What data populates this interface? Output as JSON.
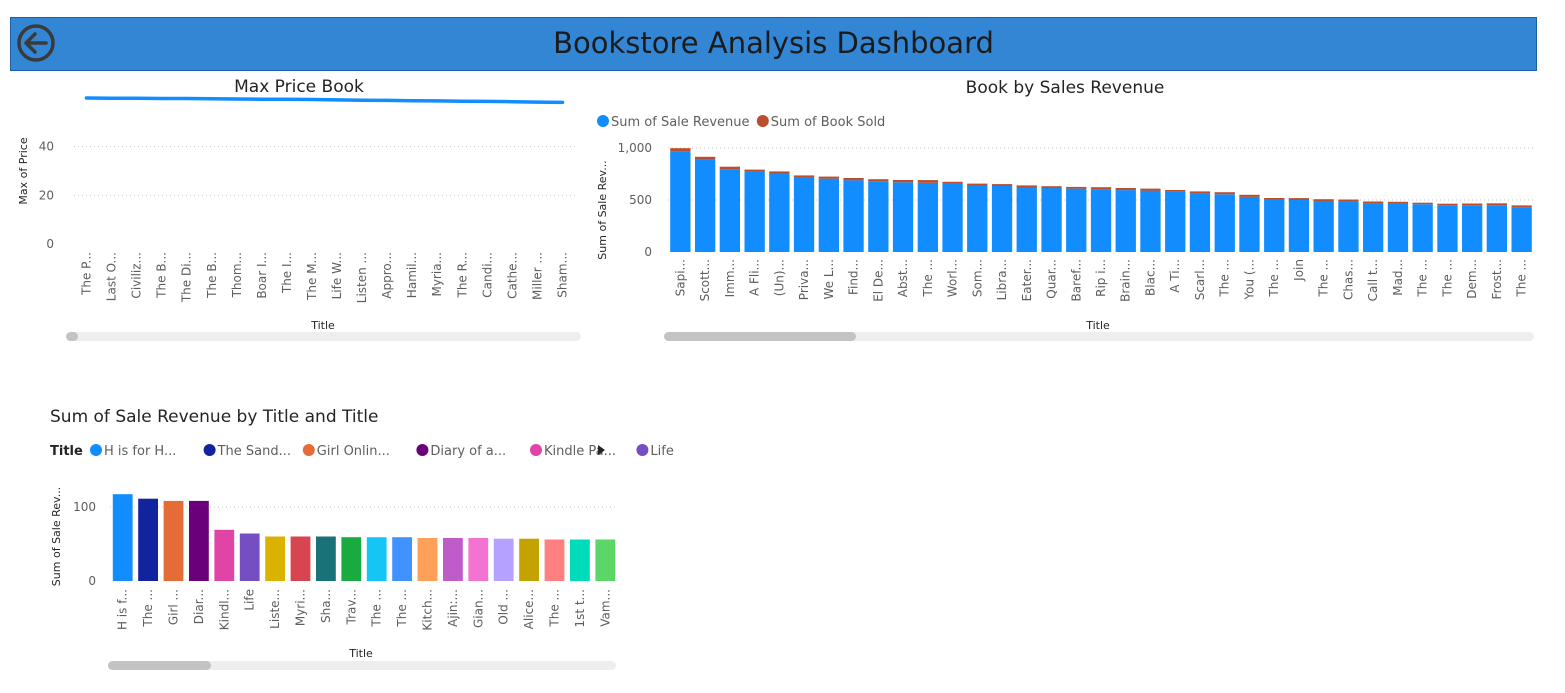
{
  "header": {
    "title": "Bookstore Analysis Dashboard",
    "back_icon": "back-arrow-circle-icon",
    "color": "#3386d4"
  },
  "chart_data": [
    {
      "id": "max_price",
      "type": "line",
      "title": "Max Price Book",
      "xlabel": "Title",
      "ylabel": "Max of Price",
      "ylim": [
        0,
        60
      ],
      "yticks": [
        0,
        20,
        40
      ],
      "grid": true,
      "color": "#118dff",
      "categories": [
        "The P...",
        "Last O...",
        "Civiliz...",
        "The B...",
        "The Di...",
        "The B...",
        "Thom...",
        "Boar I...",
        "The I...",
        "The M...",
        "Life W...",
        "Listen ...",
        "Appro...",
        "Hamil...",
        "Myria...",
        "The R...",
        "Candi...",
        "Cathe...",
        "Miller ...",
        "Sham..."
      ],
      "values": [
        60.0,
        59.9,
        59.9,
        59.8,
        59.8,
        59.7,
        59.6,
        59.5,
        59.5,
        59.4,
        59.2,
        59.1,
        59.0,
        58.9,
        58.8,
        58.7,
        58.6,
        58.5,
        58.3,
        58.2
      ]
    },
    {
      "id": "sales_revenue",
      "type": "bar",
      "stacked": true,
      "title": "Book by Sales Revenue",
      "xlabel": "Title",
      "ylabel": "Sum of Sale Rev...",
      "ylim": [
        0,
        1000
      ],
      "yticks": [
        0,
        500,
        1000
      ],
      "ytick_labels": [
        "0",
        "500",
        "1,000"
      ],
      "grid": true,
      "legend_position": "top-left",
      "categories": [
        "Sapi...",
        "Scott...",
        "Imm...",
        "A Fli...",
        "(Un)...",
        "Priva...",
        "We L...",
        "Find...",
        "El De...",
        "Abst...",
        "The ...",
        "Worl...",
        "Som...",
        "Libra...",
        "Eater...",
        "Quar...",
        "Baref...",
        "Rip i...",
        "Brain...",
        "Blac...",
        "A Ti...",
        "Scarl...",
        "The ...",
        "You (...",
        "The ...",
        "Join",
        "The ...",
        "Chas...",
        "Call t...",
        "Mad...",
        "The ...",
        "The ...",
        "Dem...",
        "Frost...",
        "The ..."
      ],
      "series": [
        {
          "name": "Sum of Sale Revenue",
          "color": "#118dff",
          "values": [
            970,
            885,
            795,
            770,
            755,
            715,
            705,
            690,
            680,
            670,
            665,
            655,
            640,
            635,
            620,
            615,
            610,
            605,
            595,
            590,
            580,
            565,
            555,
            530,
            505,
            500,
            490,
            485,
            470,
            465,
            460,
            450,
            450,
            450,
            430
          ]
        },
        {
          "name": "Sum of Book Sold",
          "color": "#b94f2e",
          "values": [
            28,
            30,
            25,
            22,
            20,
            22,
            20,
            22,
            20,
            22,
            26,
            20,
            18,
            18,
            20,
            18,
            16,
            18,
            20,
            20,
            16,
            18,
            20,
            20,
            14,
            18,
            18,
            20,
            16,
            18,
            14,
            14,
            16,
            18,
            18
          ]
        }
      ]
    },
    {
      "id": "revenue_by_title",
      "type": "bar",
      "title": "Sum of Sale Revenue by Title and Title",
      "xlabel": "Title",
      "ylabel": "Sum of Sale Rev...",
      "ylim": [
        0,
        120
      ],
      "yticks": [
        0,
        100
      ],
      "grid": true,
      "legend_title": "Title",
      "legend_position": "top-left",
      "legend": [
        {
          "name": "H is for H...",
          "color": "#118dff"
        },
        {
          "name": "The Sand...",
          "color": "#12239e"
        },
        {
          "name": "Girl Onlin...",
          "color": "#e66c37"
        },
        {
          "name": "Diary of a...",
          "color": "#6b007b"
        },
        {
          "name": "Kindle Pa...",
          "color": "#e044a7"
        },
        {
          "name": "Life",
          "color": "#744ec2"
        }
      ],
      "categories": [
        "H is f...",
        "The ...",
        "Girl ...",
        "Diar...",
        "Kindl...",
        "Life",
        "Liste...",
        "Myri...",
        "Sha...",
        "Trav...",
        "The ...",
        "The ...",
        "Kitch...",
        "Ajin:...",
        "Gian...",
        "Old ...",
        "Alice...",
        "The ...",
        "1st t...",
        "Vam..."
      ],
      "values": [
        117,
        111,
        108,
        108,
        69,
        64,
        60,
        60,
        60,
        59,
        59,
        59,
        58,
        58,
        58,
        57,
        57,
        56,
        56,
        56
      ],
      "colors": [
        "#118dff",
        "#12239e",
        "#e66c37",
        "#6b007b",
        "#e044a7",
        "#744ec2",
        "#d9b300",
        "#d64550",
        "#197278",
        "#1aab40",
        "#15c6f4",
        "#4092ff",
        "#ffa058",
        "#be5dc9",
        "#f472d0",
        "#b5a1ff",
        "#c4a200",
        "#ff8080",
        "#00dbbc",
        "#5bd667"
      ]
    }
  ]
}
